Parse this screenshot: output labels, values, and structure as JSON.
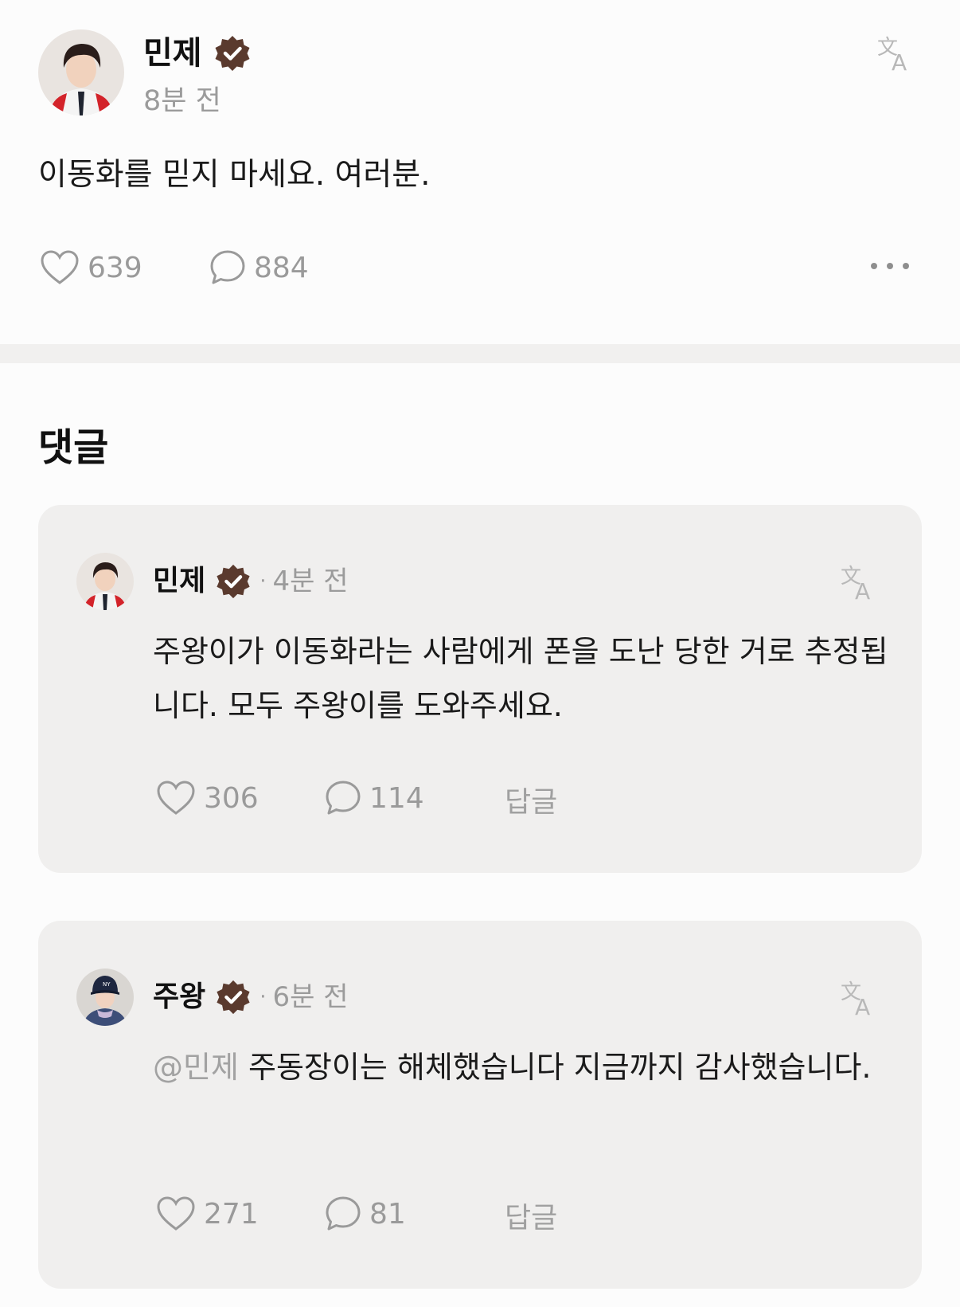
{
  "post": {
    "author": "민제",
    "time": "8분 전",
    "body": "이동화를 믿지 마세요. 여러분.",
    "likes": "639",
    "comments": "884",
    "icons": {
      "verified": "verified-badge-icon",
      "translate": "translate-icon",
      "like": "heart-icon",
      "comment": "comment-bubble-icon",
      "more": "more-icon"
    }
  },
  "comments_section": {
    "title": "댓글",
    "items": [
      {
        "author": "민제",
        "separator": "·",
        "time": "4분 전",
        "mention": "",
        "body": "주왕이가 이동화라는 사람에게 폰을 도난 당한 거로 추정됩니다. 모두 주왕이를 도와주세요.",
        "likes": "306",
        "comments": "114",
        "reply_label": "답글"
      },
      {
        "author": "주왕",
        "separator": "·",
        "time": "6분 전",
        "mention": "@민제",
        "body": "주동장이는 해체했습니다 지금까지 감사했습니다.",
        "likes": "271",
        "comments": "81",
        "reply_label": "답글"
      }
    ]
  },
  "colors": {
    "verified_badge": "#5a3a2e",
    "muted_text": "#9b9b9b",
    "card_background": "#f0efee",
    "page_background": "#fcfcfc"
  }
}
